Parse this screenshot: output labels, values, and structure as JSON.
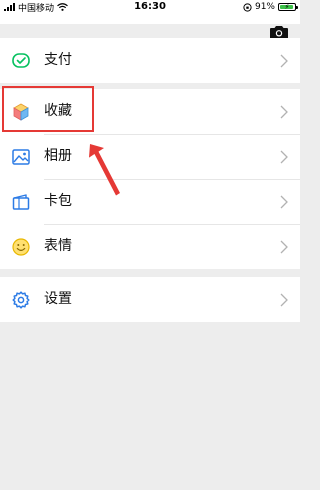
{
  "status_bar": {
    "carrier": "中国移动",
    "time": "16:30",
    "battery_percent": "91%",
    "battery_level": 0.91,
    "icons": [
      "signal-icon",
      "wifi-icon",
      "orientation-lock-icon",
      "battery-icon"
    ]
  },
  "header": {
    "camera_icon": "camera-icon"
  },
  "menu": {
    "groups": [
      {
        "items": [
          {
            "label": "支付",
            "icon": "wechat-pay-icon",
            "icon_color": "#07C160"
          }
        ]
      },
      {
        "items": [
          {
            "label": "收藏",
            "icon": "favorites-cube-icon",
            "icon_color": "#F3A83B"
          },
          {
            "label": "相册",
            "icon": "album-icon",
            "icon_color": "#2C7BE5"
          },
          {
            "label": "卡包",
            "icon": "card-wallet-icon",
            "icon_color": "#2C7BE5"
          },
          {
            "label": "表情",
            "icon": "emoji-icon",
            "icon_color": "#F5C518"
          }
        ]
      },
      {
        "items": [
          {
            "label": "设置",
            "icon": "settings-gear-icon",
            "icon_color": "#2C7BE5"
          }
        ]
      }
    ]
  },
  "annotation": {
    "highlight_color": "#E53935",
    "highlighted_item": "收藏"
  },
  "colors": {
    "background": "#EDEDED",
    "surface": "#FFFFFF",
    "divider": "#E6E6E6",
    "chevron": "#B2B2B2"
  }
}
